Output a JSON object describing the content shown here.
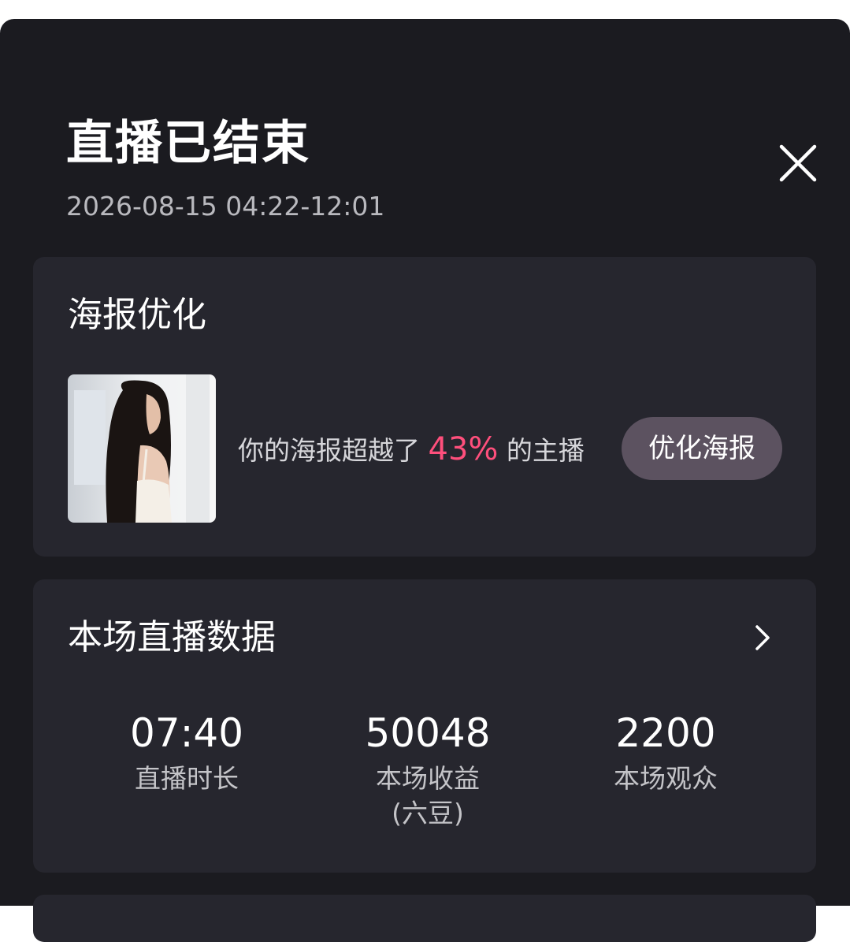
{
  "header": {
    "title": "直播已结束",
    "time_range": "2026-08-15 04:22-12:01"
  },
  "poster_card": {
    "heading": "海报优化",
    "text_before": "你的海报超越了",
    "percent": "43%",
    "text_after": "的主播",
    "button_label": "优化海报"
  },
  "stats_card": {
    "heading": "本场直播数据",
    "items": [
      {
        "value": "07:40",
        "label": "直播时长"
      },
      {
        "value": "50048",
        "label": "本场收益\n(六豆)"
      },
      {
        "value": "2200",
        "label": "本场观众"
      }
    ]
  },
  "colors": {
    "background": "#1b1b20",
    "card": "#26262e",
    "accent": "#ff4f7c",
    "button": "#5c5260"
  },
  "icons": [
    "close-icon",
    "chevron-right-icon"
  ]
}
